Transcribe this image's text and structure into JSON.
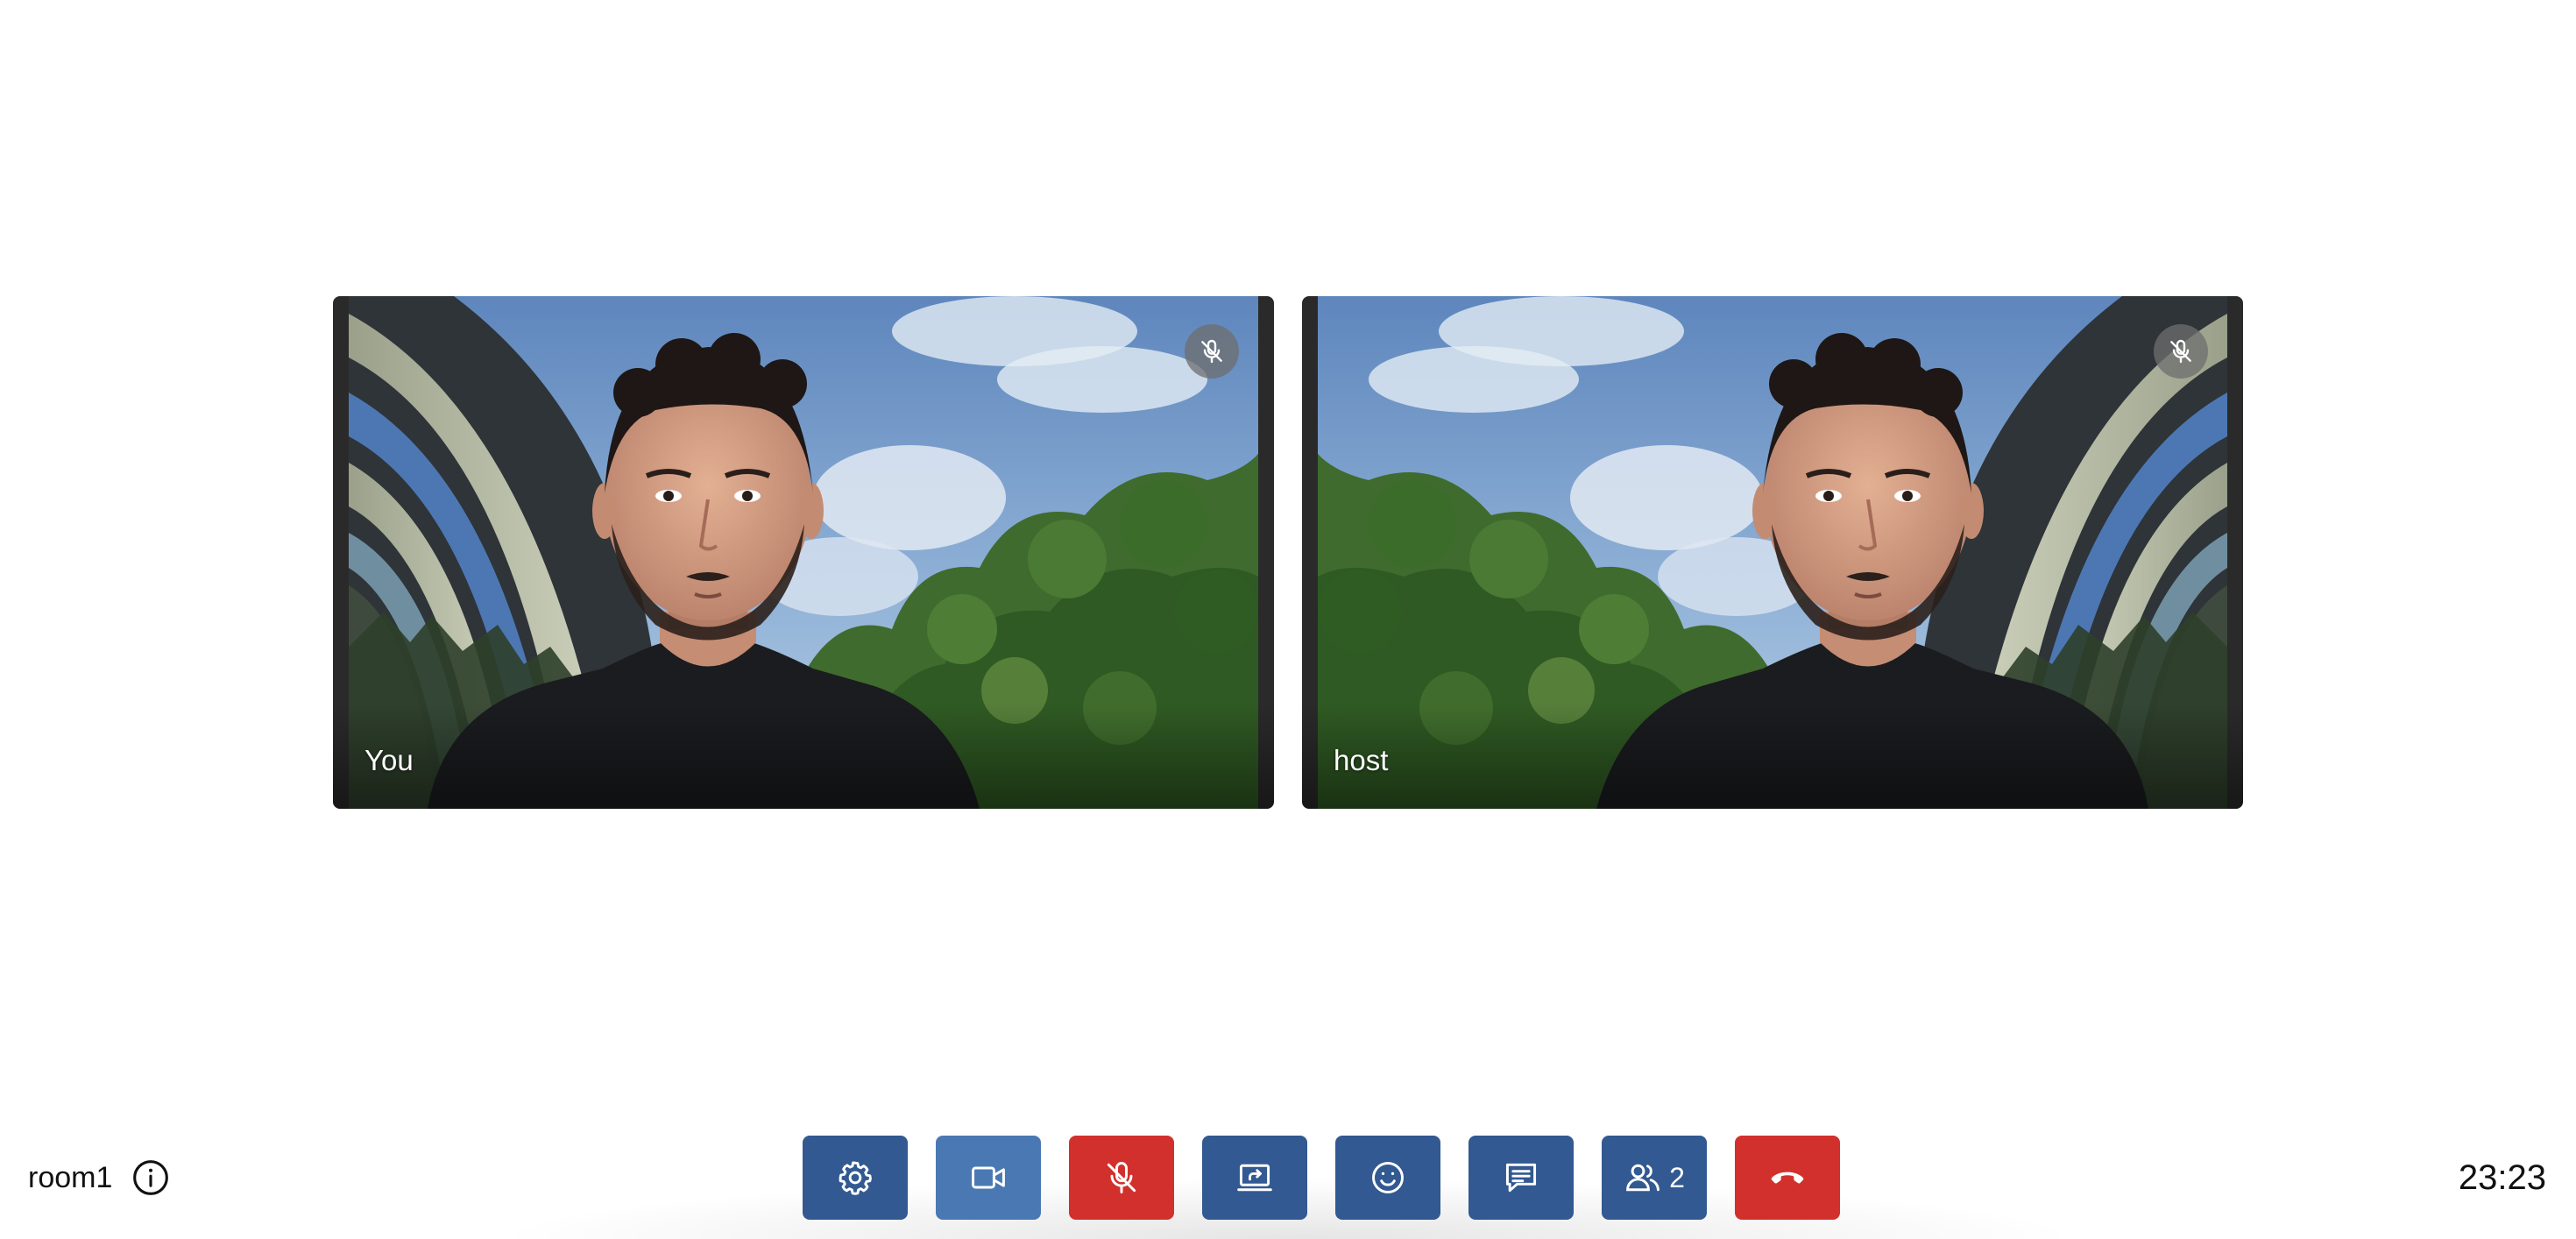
{
  "participants": [
    {
      "name": "You",
      "muted": true
    },
    {
      "name": "host",
      "muted": true
    }
  ],
  "room": {
    "name": "room1",
    "info_icon": "info-icon"
  },
  "clock": {
    "time": "23:23"
  },
  "toolbar": {
    "settings_icon": "gear-icon",
    "camera_icon": "video-camera-icon",
    "mic_icon": "microphone-off-icon",
    "share_icon": "screen-share-icon",
    "reactions_icon": "smiley-icon",
    "chat_icon": "chat-icon",
    "participants_icon": "people-icon",
    "participants_count": "2",
    "hangup_icon": "hang-up-icon"
  },
  "colors": {
    "button_blue": "#325991",
    "button_blue_active": "#4a78b3",
    "button_red": "#d2302c"
  }
}
